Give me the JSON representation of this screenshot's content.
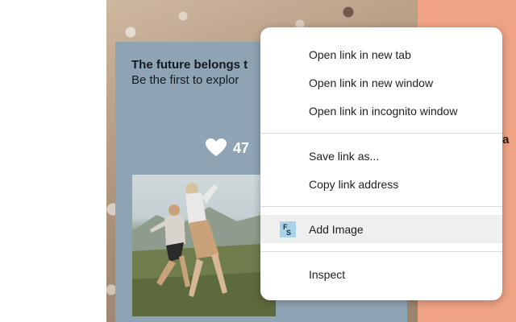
{
  "card": {
    "title": "The future belongs t",
    "subtitle": "Be the first to explor",
    "like_count": "47"
  },
  "salmon_text": "t a\nt",
  "context_menu": {
    "groups": [
      [
        {
          "label": "Open link in new tab"
        },
        {
          "label": "Open link in new window"
        },
        {
          "label": "Open link in incognito window"
        }
      ],
      [
        {
          "label": "Save link as..."
        },
        {
          "label": "Copy link address"
        }
      ],
      [
        {
          "label": "Add Image",
          "icon": "fs-extension-icon",
          "highlighted": true
        }
      ],
      [
        {
          "label": "Inspect"
        }
      ]
    ]
  },
  "colors": {
    "card_bg": "#8ea3b4",
    "salmon": "#efa384",
    "menu_highlight": "#efefef"
  }
}
